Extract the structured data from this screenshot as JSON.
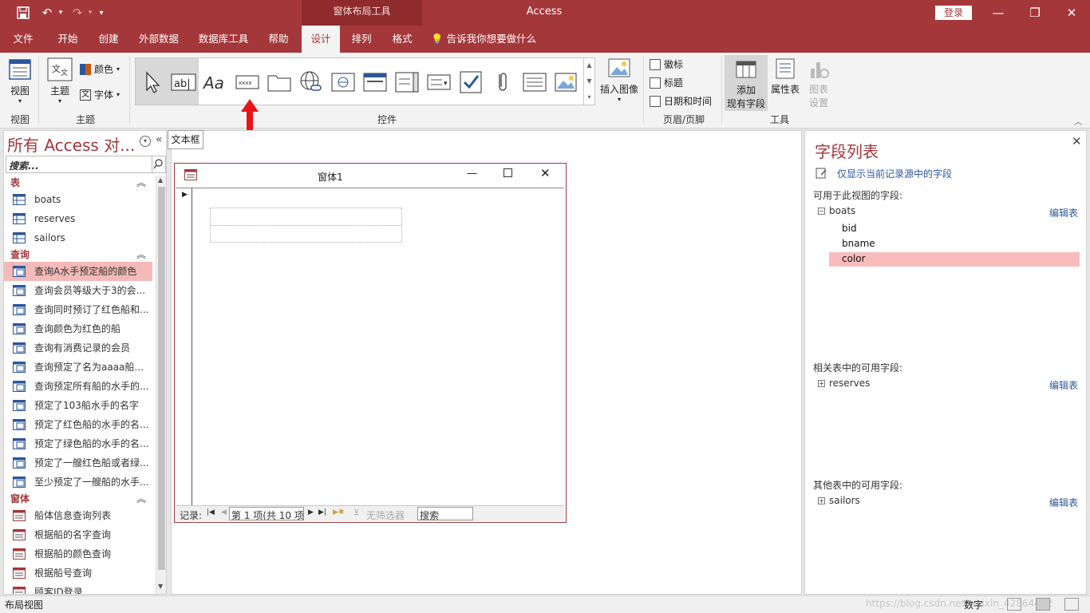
{
  "titlebar": {
    "context_tab_title": "窗体布局工具",
    "app_title": "Access",
    "login": "登录",
    "minimize": "—",
    "restore": "❐",
    "close": "✕"
  },
  "tabs": [
    {
      "label": "文件"
    },
    {
      "label": "开始"
    },
    {
      "label": "创建"
    },
    {
      "label": "外部数据"
    },
    {
      "label": "数据库工具"
    },
    {
      "label": "帮助"
    },
    {
      "label": "设计"
    },
    {
      "label": "排列"
    },
    {
      "label": "格式"
    }
  ],
  "tellme": "告诉我你想要做什么",
  "ribbon": {
    "view_label": "视图",
    "theme_label": "主题",
    "colors_label": "颜色",
    "fonts_label": "字体",
    "group_view": "视图",
    "group_theme": "主题",
    "group_controls": "控件",
    "insert_image": "插入图像",
    "logo": "徽标",
    "title": "标题",
    "date_time": "日期和时间",
    "group_header_footer": "页眉/页脚",
    "add_existing_fields_1": "添加",
    "add_existing_fields_2": "现有字段",
    "property_sheet": "属性表",
    "chart_settings_1": "图表",
    "chart_settings_2": "设置",
    "group_tools": "工具",
    "label_control_text": "xxxx",
    "textbox_control_text": "ab|"
  },
  "tooltip": "文本框",
  "nav": {
    "title": "所有 Access 对...",
    "search_placeholder": "搜索...",
    "sections": {
      "tables": "表",
      "queries": "查询",
      "forms": "窗体"
    },
    "tables": [
      "boats",
      "reserves",
      "sailors"
    ],
    "queries": [
      "查询A水手预定船的颜色",
      "查询会员等级大于3的会...",
      "查询同时预订了红色船和...",
      "查询颜色为红色的船",
      "查询有消费记录的会员",
      "查询预定了名为aaaa船...",
      "查询预定所有船的水手的...",
      "预定了103船水手的名字",
      "预定了红色船的水手的名...",
      "预定了绿色船的水手的名...",
      "预定了一艘红色船或者绿...",
      "至少预定了一艘船的水手..."
    ],
    "forms": [
      "船体信息查询列表",
      "根据船的名字查询",
      "根据船的颜色查询",
      "根据船号查询",
      "顾客ID登录"
    ]
  },
  "form_window": {
    "title": "窗体1",
    "record_label": "记录:",
    "record_position": "第 1 项(共 10 项",
    "no_filter": "无筛选器",
    "search": "搜索"
  },
  "field_list": {
    "title": "字段列表",
    "show_only_current": "仅显示当前记录源中的字段",
    "available_label": "可用于此视图的字段:",
    "table": "boats",
    "edit_table": "编辑表",
    "fields": [
      "bid",
      "bname",
      "color"
    ],
    "related_label": "相关表中的可用字段:",
    "related_table": "reserves",
    "other_label": "其他表中的可用字段:",
    "other_table": "sailors"
  },
  "status": {
    "left": "布局视图",
    "right": "数字",
    "watermark": "https://blog.csdn.net/weixin_42864422"
  },
  "colors": {
    "accent": "#a4373a",
    "selection": "#f9bcbc",
    "arrow": "#e8141a"
  }
}
